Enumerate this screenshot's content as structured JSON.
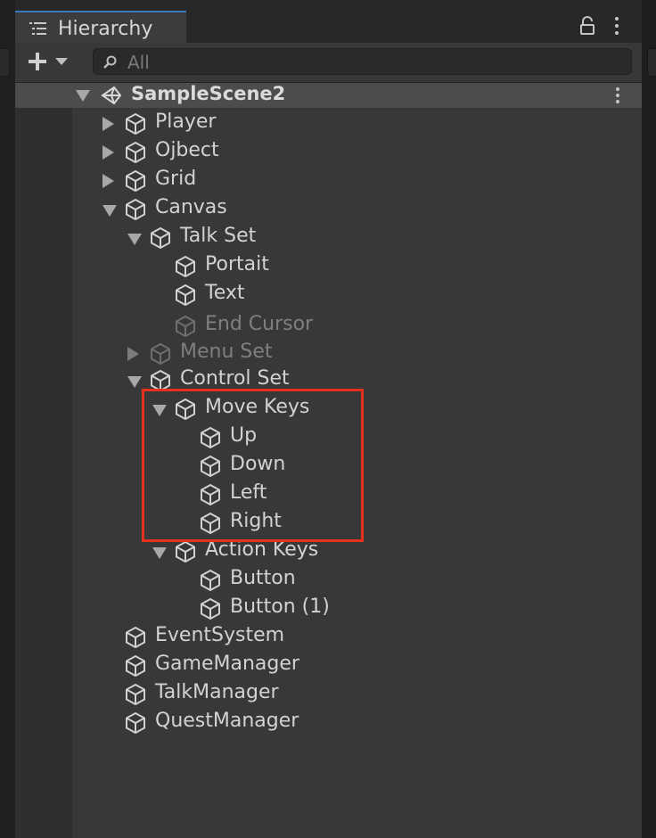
{
  "window": {
    "tab_title": "Hierarchy"
  },
  "toolbar": {
    "add_icon": "plus-icon",
    "search_placeholder": "All"
  },
  "scene": {
    "name": "SampleScene2"
  },
  "tree": [
    {
      "label": "Player",
      "depth": 0,
      "expander": "collapsed",
      "active": true
    },
    {
      "label": "Ojbect",
      "depth": 0,
      "expander": "collapsed",
      "active": true
    },
    {
      "label": "Grid",
      "depth": 0,
      "expander": "collapsed",
      "active": true
    },
    {
      "label": "Canvas",
      "depth": 0,
      "expander": "expanded",
      "active": true
    },
    {
      "label": "Talk Set",
      "depth": 1,
      "expander": "expanded",
      "active": true
    },
    {
      "label": "Portait",
      "depth": 2,
      "expander": "none",
      "active": true
    },
    {
      "label": "Text",
      "depth": 2,
      "expander": "none",
      "active": true
    },
    {
      "label": "End Cursor",
      "depth": 2,
      "expander": "none",
      "active": false
    },
    {
      "label": "Menu Set",
      "depth": 1,
      "expander": "collapsed",
      "active": false
    },
    {
      "label": "Control Set",
      "depth": 1,
      "expander": "expanded",
      "active": true
    },
    {
      "label": "Move Keys",
      "depth": 2,
      "expander": "expanded",
      "active": true
    },
    {
      "label": "Up",
      "depth": 3,
      "expander": "none",
      "active": true
    },
    {
      "label": "Down",
      "depth": 3,
      "expander": "none",
      "active": true
    },
    {
      "label": "Left",
      "depth": 3,
      "expander": "none",
      "active": true
    },
    {
      "label": "Right",
      "depth": 3,
      "expander": "none",
      "active": true
    },
    {
      "label": "Action Keys",
      "depth": 2,
      "expander": "expanded",
      "active": true
    },
    {
      "label": "Button",
      "depth": 3,
      "expander": "none",
      "active": true
    },
    {
      "label": "Button (1)",
      "depth": 3,
      "expander": "none",
      "active": true
    },
    {
      "label": "EventSystem",
      "depth": 0,
      "expander": "none",
      "active": true
    },
    {
      "label": "GameManager",
      "depth": 0,
      "expander": "none",
      "active": true
    },
    {
      "label": "TalkManager",
      "depth": 0,
      "expander": "none",
      "active": true
    },
    {
      "label": "QuestManager",
      "depth": 0,
      "expander": "none",
      "active": true
    }
  ],
  "annotation": {
    "color": "#e8311c",
    "encloses": [
      "Move Keys",
      "Up",
      "Down",
      "Left",
      "Right"
    ]
  },
  "colors": {
    "panel_bg": "#383838",
    "scene_header_bg": "#4c4c4c",
    "tab_accent": "#3a79bb",
    "text": "#d2d2d2",
    "inactive_text": "#7f7f7f"
  }
}
